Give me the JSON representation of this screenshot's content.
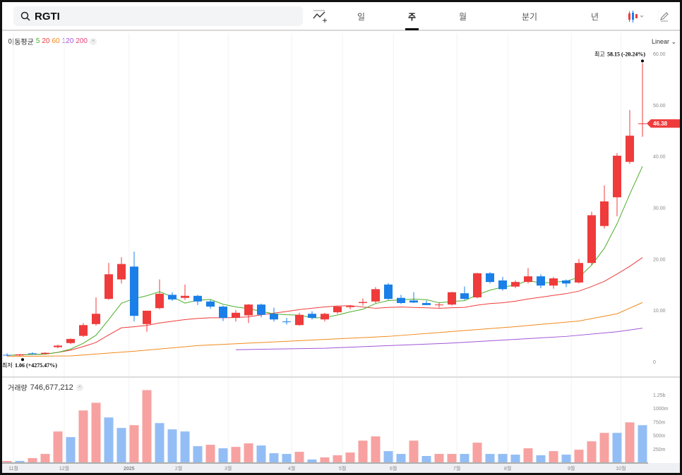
{
  "search": {
    "query": "RGTI"
  },
  "toolbar": {
    "tabs": [
      {
        "label": "일",
        "active": false
      },
      {
        "label": "주",
        "active": true
      },
      {
        "label": "월",
        "active": false
      },
      {
        "label": "분기",
        "active": false
      },
      {
        "label": "년",
        "active": false
      }
    ]
  },
  "ma_legend": {
    "label": "이동평균",
    "periods": [
      {
        "p": "5",
        "color": "#4caf2a"
      },
      {
        "p": "20",
        "color": "#ef3b3b"
      },
      {
        "p": "60",
        "color": "#f08a1c"
      },
      {
        "p": "120",
        "color": "#a055d6"
      },
      {
        "p": "200",
        "color": "#e8437a"
      }
    ],
    "close": "×"
  },
  "scale_mode": "Linear ⌄",
  "colors": {
    "up": "#ef3b3b",
    "down": "#1a7fe8",
    "vol_up": "#f7a1a1",
    "vol_down": "#93bdf5"
  },
  "annotations": {
    "high_label": "최고",
    "high_value": "58.15 (-20.24%)",
    "low_label": "최저",
    "low_value": "1.06 (+4275.47%)",
    "current_price": "46.38"
  },
  "volume": {
    "label": "거래량",
    "value": "746,677,212",
    "close": "×"
  },
  "chart_data": {
    "type": "candlestick",
    "price_ticks": [
      "0",
      "10.00",
      "20.00",
      "30.00",
      "40.00",
      "50.00",
      "60.00"
    ],
    "ylim": [
      0,
      60
    ],
    "volume_ticks": [
      {
        "v": 250,
        "l": "250m"
      },
      {
        "v": 500,
        "l": "500m"
      },
      {
        "v": 750,
        "l": "750m"
      },
      {
        "v": 1000,
        "l": "1000m"
      },
      {
        "v": 1250,
        "l": "1.25b"
      }
    ],
    "vlim": [
      0,
      1250
    ],
    "x_labels": [
      {
        "i": 0.5,
        "l": "11월"
      },
      {
        "i": 4.5,
        "l": "12월"
      },
      {
        "i": 9.6,
        "l": "2025"
      },
      {
        "i": 13.5,
        "l": "2월"
      },
      {
        "i": 17.4,
        "l": "3월"
      },
      {
        "i": 22.4,
        "l": "4월"
      },
      {
        "i": 26.4,
        "l": "5월"
      },
      {
        "i": 30.4,
        "l": "6월"
      },
      {
        "i": 35.4,
        "l": "7월"
      },
      {
        "i": 39.4,
        "l": "8월"
      },
      {
        "i": 44.4,
        "l": "9월"
      },
      {
        "i": 48.3,
        "l": "10월"
      }
    ],
    "candles": [
      [
        1.3,
        1.6,
        1.06,
        1.2
      ],
      [
        1.2,
        1.5,
        1.1,
        1.4
      ],
      [
        1.6,
        1.8,
        1.3,
        1.5
      ],
      [
        1.5,
        1.8,
        1.4,
        1.7
      ],
      [
        2.8,
        3.3,
        2.6,
        3.1
      ],
      [
        3.6,
        4.5,
        3.4,
        4.4
      ],
      [
        5.0,
        7.5,
        4.8,
        7.1
      ],
      [
        7.3,
        12.5,
        7.0,
        9.3
      ],
      [
        12.2,
        19.2,
        12.0,
        17.0
      ],
      [
        16.0,
        20.3,
        15.2,
        19.0
      ],
      [
        18.5,
        21.4,
        7.8,
        8.9
      ],
      [
        7.3,
        9.9,
        5.8,
        9.9
      ],
      [
        10.4,
        16.0,
        10.2,
        13.2
      ],
      [
        13.0,
        13.5,
        11.8,
        12.1
      ],
      [
        12.4,
        15.0,
        12.0,
        12.8
      ],
      [
        12.8,
        13.0,
        11.0,
        11.7
      ],
      [
        11.7,
        12.0,
        10.3,
        10.7
      ],
      [
        10.7,
        10.9,
        7.9,
        8.5
      ],
      [
        8.5,
        10.0,
        7.8,
        9.5
      ],
      [
        9.0,
        11.2,
        7.5,
        11.1
      ],
      [
        11.1,
        11.3,
        8.6,
        9.1
      ],
      [
        9.3,
        10.5,
        7.8,
        8.2
      ],
      [
        7.8,
        8.5,
        7.2,
        7.7
      ],
      [
        7.1,
        9.5,
        7.0,
        9.1
      ],
      [
        9.3,
        9.8,
        8.2,
        8.5
      ],
      [
        8.2,
        9.5,
        7.8,
        9.3
      ],
      [
        9.6,
        10.9,
        9.3,
        10.7
      ],
      [
        10.6,
        11.0,
        10.2,
        10.8
      ],
      [
        11.4,
        12.3,
        10.9,
        11.6
      ],
      [
        11.7,
        14.5,
        11.4,
        14.1
      ],
      [
        15.0,
        15.3,
        12.0,
        12.2
      ],
      [
        12.4,
        13.0,
        11.2,
        11.4
      ],
      [
        11.9,
        13.5,
        11.4,
        11.5
      ],
      [
        11.4,
        11.9,
        11.0,
        11.0
      ],
      [
        11.0,
        11.5,
        10.5,
        11.1
      ],
      [
        11.1,
        13.6,
        10.9,
        13.5
      ],
      [
        13.3,
        14.6,
        12.0,
        12.2
      ],
      [
        12.5,
        17.3,
        12.3,
        17.2
      ],
      [
        17.2,
        17.4,
        15.2,
        15.5
      ],
      [
        15.8,
        16.5,
        13.8,
        14.1
      ],
      [
        14.6,
        15.8,
        14.3,
        15.5
      ],
      [
        15.5,
        18.2,
        15.2,
        16.6
      ],
      [
        16.6,
        17.0,
        14.3,
        14.8
      ],
      [
        14.8,
        16.5,
        14.2,
        16.2
      ],
      [
        15.8,
        16.0,
        14.5,
        15.2
      ],
      [
        15.4,
        20.0,
        15.2,
        19.2
      ],
      [
        19.2,
        29.2,
        18.8,
        28.5
      ],
      [
        26.4,
        34.3,
        25.9,
        31.2
      ],
      [
        32.0,
        40.6,
        28.3,
        40.1
      ],
      [
        38.9,
        49.0,
        38.5,
        44.0
      ],
      [
        46.3,
        58.15,
        43.8,
        46.38
      ]
    ],
    "volume_m": [
      25,
      25,
      78,
      155,
      570,
      466,
      958,
      1100,
      829,
      635,
      686,
      1334,
      725,
      609,
      570,
      298,
      324,
      259,
      285,
      350,
      311,
      168,
      155,
      194,
      52,
      91,
      130,
      181,
      401,
      479,
      207,
      155,
      401,
      117,
      155,
      155,
      155,
      363,
      155,
      155,
      142,
      259,
      130,
      207,
      142,
      233,
      388,
      544,
      544,
      738,
      686
    ],
    "volume_up": [
      1,
      0,
      1,
      1,
      1,
      0,
      1,
      1,
      0,
      0,
      1,
      1,
      0,
      0,
      0,
      0,
      1,
      0,
      1,
      1,
      0,
      0,
      0,
      1,
      0,
      1,
      1,
      1,
      1,
      1,
      0,
      0,
      1,
      0,
      1,
      1,
      0,
      1,
      0,
      0,
      0,
      1,
      0,
      1,
      0,
      1,
      1,
      1,
      0,
      1,
      0
    ],
    "ma60_points": [
      [
        0,
        1.0
      ],
      [
        5,
        1.1
      ],
      [
        10,
        2.0
      ],
      [
        15,
        3.1
      ],
      [
        20,
        3.7
      ],
      [
        30,
        4.9
      ],
      [
        40,
        6.8
      ],
      [
        45,
        7.9
      ],
      [
        48,
        9.3
      ],
      [
        50,
        11.5
      ]
    ],
    "ma120_points": [
      [
        18,
        2.3
      ],
      [
        25,
        2.6
      ],
      [
        35,
        3.6
      ],
      [
        44,
        4.9
      ],
      [
        48,
        5.8
      ],
      [
        50,
        6.5
      ]
    ]
  }
}
